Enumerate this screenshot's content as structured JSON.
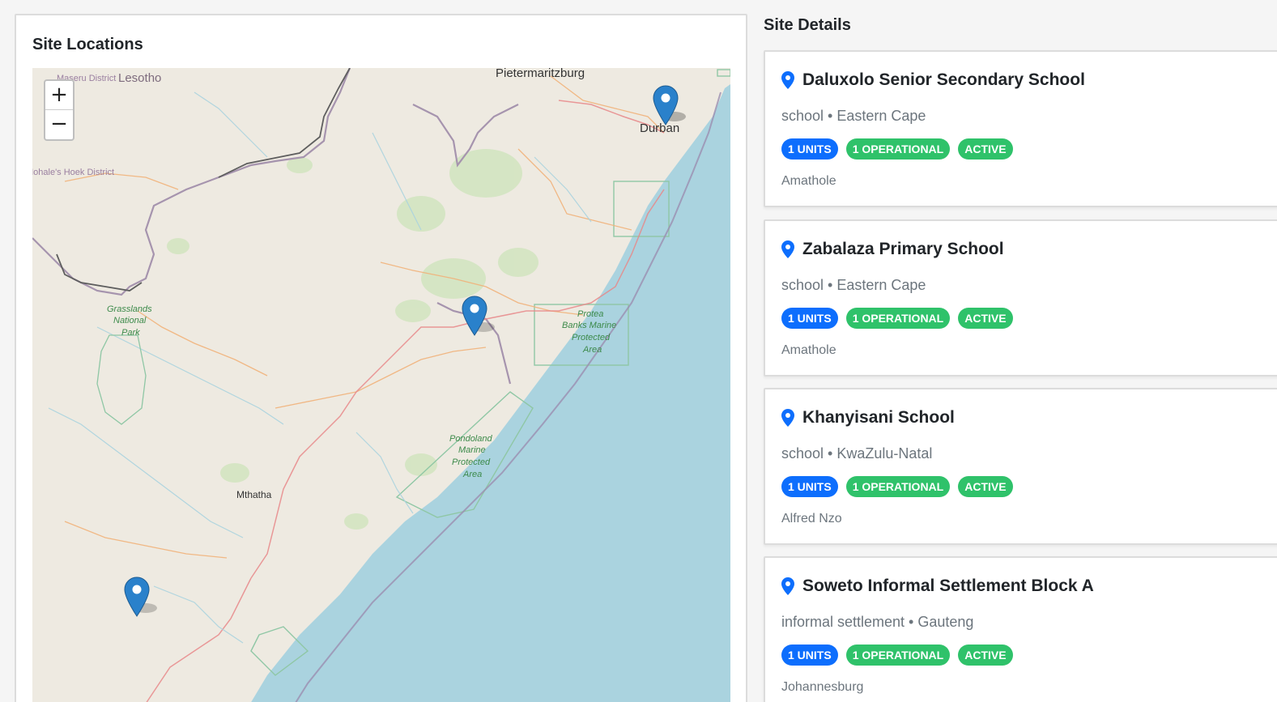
{
  "map_panel": {
    "title": "Site Locations",
    "zoom_in": "+",
    "zoom_out": "−",
    "labels": {
      "lesotho": "Lesotho",
      "maseru_district": "Maseru District",
      "mohales": "Mohale's Hoek District",
      "pietermaritzburg": "Pietermaritzburg",
      "durban": "Durban",
      "grasslands_1": "Grasslands",
      "grasslands_2": "National",
      "grasslands_3": "Park",
      "protea_1": "Protea",
      "protea_2": "Banks Marine",
      "protea_3": "Protected",
      "protea_4": "Area",
      "pondoland_1": "Pondoland",
      "pondoland_2": "Marine",
      "pondoland_3": "Protected",
      "pondoland_4": "Area",
      "mthatha": "Mthatha"
    }
  },
  "details_panel": {
    "title": "Site Details",
    "sites": [
      {
        "name": "Daluxolo Senior Secondary School",
        "meta": "school • Eastern Cape",
        "units": "1 UNITS",
        "operational": "1 OPERATIONAL",
        "status": "ACTIVE",
        "district": "Amathole"
      },
      {
        "name": "Zabalaza Primary School",
        "meta": "school • Eastern Cape",
        "units": "1 UNITS",
        "operational": "1 OPERATIONAL",
        "status": "ACTIVE",
        "district": "Amathole"
      },
      {
        "name": "Khanyisani School",
        "meta": "school • KwaZulu-Natal",
        "units": "1 UNITS",
        "operational": "1 OPERATIONAL",
        "status": "ACTIVE",
        "district": "Alfred Nzo"
      },
      {
        "name": "Soweto Informal Settlement Block A",
        "meta": "informal settlement • Gauteng",
        "units": "1 UNITS",
        "operational": "1 OPERATIONAL",
        "status": "ACTIVE",
        "district": "Johannesburg"
      }
    ]
  },
  "colors": {
    "accent_blue": "#0d6efd",
    "operational_green": "#2fc26a",
    "marker_blue": "#2a81cb",
    "sea": "#aad3df",
    "land": "#eeeae1"
  },
  "icons": {
    "site_pin": "map-pin-icon",
    "map_marker": "map-marker-icon"
  }
}
